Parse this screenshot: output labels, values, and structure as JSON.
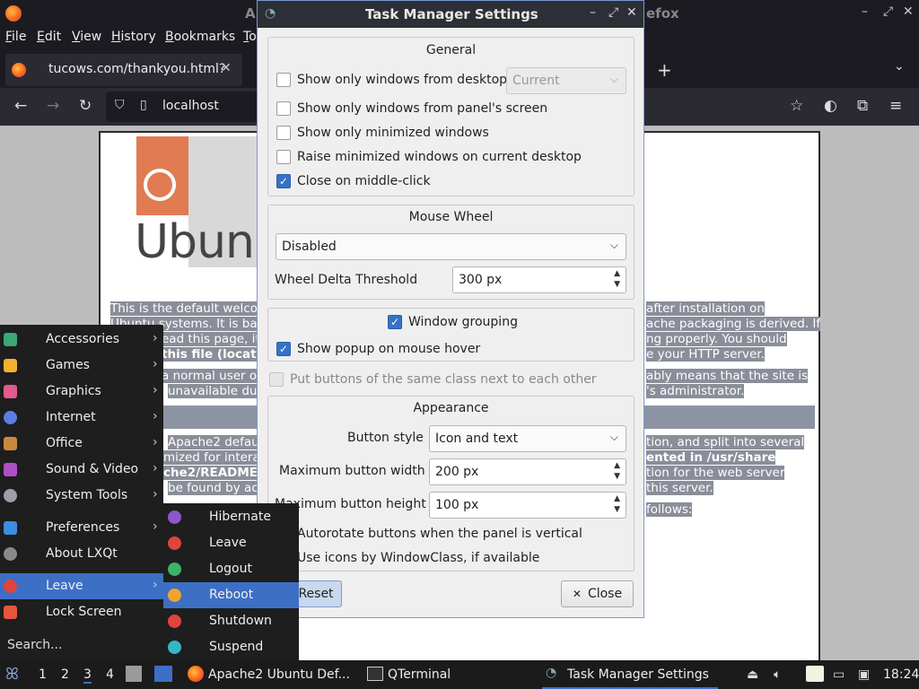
{
  "firefox": {
    "title_left": "A",
    "title_right": "efox",
    "menu": [
      "File",
      "Edit",
      "View",
      "History",
      "Bookmarks",
      "To"
    ],
    "menu_underline": [
      "F",
      "E",
      "V",
      "H",
      "B",
      "T"
    ],
    "tab": {
      "label": "tucows.com/thankyou.html?",
      "close": "✕"
    },
    "new_tab": "+",
    "tab_list": "⌄",
    "url": "localhost"
  },
  "page": {
    "logo_text": "Ubun",
    "lines": [
      "This is the default welco",
      "Ubuntu systems. It is bas",
      "ead this page, it",
      "this file (located",
      "a normal user o",
      "unavailable due",
      "Apache2 defau",
      "mized for intera",
      "che2/README",
      "be found by ac"
    ],
    "lines_right": [
      "after installation on",
      "ache packaging is derived. If",
      "ng properly. You should",
      "e your HTTP server.",
      "ably means that the site is",
      "'s administrator.",
      "tion, and split into several",
      "ented in /usr/share",
      "tion for the web server",
      "this server.",
      "follows:"
    ]
  },
  "dialog": {
    "title": "Task Manager Settings",
    "general": {
      "title": "General",
      "only_desktop": "Show only windows from desktop",
      "desktop_combo": "Current",
      "only_panel_screen": "Show only windows from panel's screen",
      "only_minimized": "Show only minimized windows",
      "raise_minimized": "Raise minimized windows on current desktop",
      "close_middle": "Close on middle-click"
    },
    "mouse_wheel": {
      "title": "Mouse Wheel",
      "mode": "Disabled",
      "delta_label": "Wheel Delta Threshold",
      "delta_value": "300 px"
    },
    "grouping": {
      "window_grouping": "Window grouping",
      "popup_hover": "Show popup on mouse hover"
    },
    "put_buttons": "Put buttons of the same class next to each other",
    "appearance": {
      "title": "Appearance",
      "style_label": "Button style",
      "style_value": "Icon and text",
      "max_width_label": "Maximum button width",
      "max_width_value": "200 px",
      "max_height_label": "Maximum button height",
      "max_height_value": "100 px",
      "autorotate": "Autorotate buttons when the panel is vertical",
      "use_icons": "Use icons by WindowClass, if available"
    },
    "reset": "Reset",
    "close": "Close"
  },
  "menu": {
    "items": [
      {
        "label": "Accessories",
        "icon_color": "#3aa776",
        "arrow": "›"
      },
      {
        "label": "Games",
        "icon_color": "#f2b230",
        "arrow": "›"
      },
      {
        "label": "Graphics",
        "icon_color": "#e25a8f",
        "arrow": "›"
      },
      {
        "label": "Internet",
        "icon_color": "#5b7ee5",
        "arrow": "›"
      },
      {
        "label": "Office",
        "icon_color": "#c98a3d",
        "arrow": "›"
      },
      {
        "label": "Sound & Video",
        "icon_color": "#b04fc4",
        "arrow": "›"
      },
      {
        "label": "System Tools",
        "icon_color": "#9aa0a6",
        "arrow": "›"
      },
      {
        "label": "Preferences",
        "icon_color": "#3d8de0",
        "arrow": "›"
      },
      {
        "label": "About LXQt",
        "icon_color": "#8a8a8a",
        "arrow": ""
      },
      {
        "label": "Leave",
        "icon_color": "#e0443e",
        "arrow": "›"
      },
      {
        "label": "Lock Screen",
        "icon_color": "#e8553e",
        "arrow": ""
      }
    ],
    "search": "Search..."
  },
  "leave_submenu": [
    {
      "label": "Hibernate",
      "icon_color": "#8b58c9"
    },
    {
      "label": "Leave",
      "icon_color": "#e0443e"
    },
    {
      "label": "Logout",
      "icon_color": "#3bb36a"
    },
    {
      "label": "Reboot",
      "icon_color": "#f0a430"
    },
    {
      "label": "Shutdown",
      "icon_color": "#e0443e"
    },
    {
      "label": "Suspend",
      "icon_color": "#33b7c4"
    }
  ],
  "taskbar": {
    "workspaces": [
      "1",
      "2",
      "3",
      "4"
    ],
    "tasks": [
      "Apache2 Ubuntu Def...",
      "QTerminal",
      "Task Manager Settings"
    ],
    "clock": "18:24"
  }
}
